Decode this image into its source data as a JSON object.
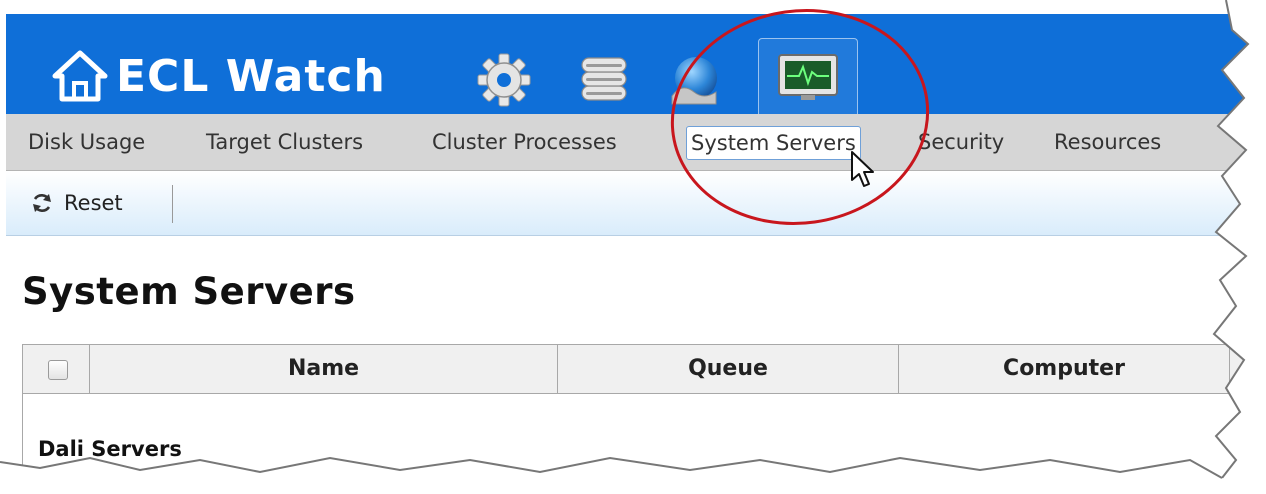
{
  "app": {
    "title": "ECL Watch"
  },
  "header": {
    "icons": [
      "home-icon",
      "settings-gear-icon",
      "database-icon",
      "globe-icon",
      "system-monitor-icon"
    ]
  },
  "menu": {
    "items": [
      {
        "label": "Disk Usage"
      },
      {
        "label": "Target Clusters"
      },
      {
        "label": "Cluster Processes"
      },
      {
        "label": "System Servers",
        "active": true
      },
      {
        "label": "Security"
      },
      {
        "label": "Resources"
      }
    ]
  },
  "toolbar": {
    "reset_label": "Reset"
  },
  "page": {
    "title": "System Servers"
  },
  "grid": {
    "columns": [
      "Name",
      "Queue",
      "Computer"
    ],
    "groups": [
      {
        "label": "Dali Servers"
      }
    ]
  },
  "colors": {
    "header_blue": "#0f6fd8",
    "menubar_gray": "#d6d6d6",
    "highlight_red": "#c8161d"
  }
}
